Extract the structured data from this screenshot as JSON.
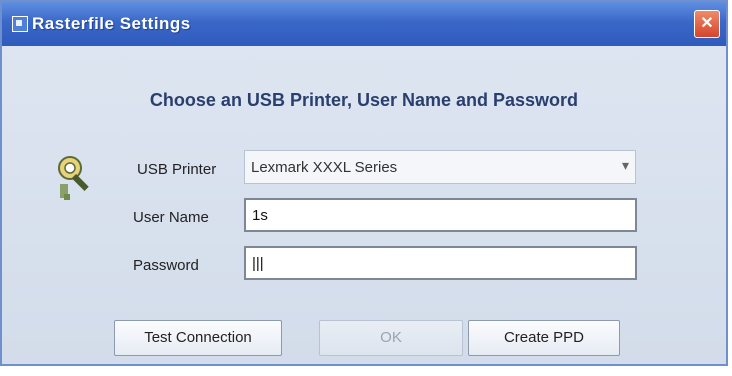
{
  "window": {
    "title": "Rasterfile Settings",
    "close_label": "✕"
  },
  "heading": "Choose an USB Printer, User Name and Password",
  "form": {
    "usb_printer_label": "USB Printer",
    "usb_printer_value": "Lexmark XXXL Series",
    "user_name_label": "User Name",
    "user_name_value": "1s",
    "password_label": "Password",
    "password_value": "|||"
  },
  "buttons": {
    "test_connection": "Test Connection",
    "ok": "OK",
    "create_ppd": "Create PPD"
  },
  "icons": {
    "title_icon": "window-icon",
    "key_icon": "key-magnifier-icon",
    "close_icon": "close-icon"
  },
  "colors": {
    "titlebar": "#3a67c8",
    "dialog_bg": "#d6dfec",
    "close_button": "#d4452a"
  }
}
